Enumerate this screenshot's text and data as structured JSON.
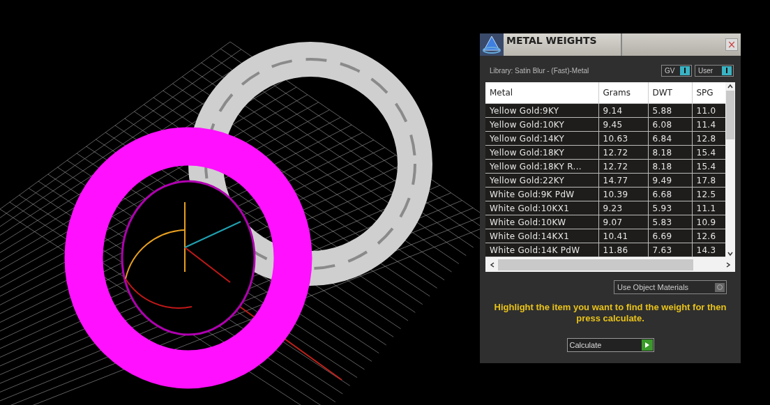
{
  "window": {
    "title": "METAL WEIGHTS",
    "close": "×"
  },
  "library": "Library: Satin Blur - (Fast)-Metal",
  "toggles": [
    {
      "label": "GV",
      "on": true
    },
    {
      "label": "User",
      "on": true
    }
  ],
  "table": {
    "columns": [
      "Metal",
      "Grams",
      "DWT",
      "SPG"
    ],
    "rows": [
      [
        "Yellow Gold:9KY",
        "9.14",
        "5.88",
        "11.0"
      ],
      [
        "Yellow Gold:10KY",
        "9.45",
        "6.08",
        "11.4"
      ],
      [
        "Yellow Gold:14KY",
        "10.63",
        "6.84",
        "12.8"
      ],
      [
        "Yellow Gold:18KY",
        "12.72",
        "8.18",
        "15.4"
      ],
      [
        "Yellow Gold:18KY R...",
        "12.72",
        "8.18",
        "15.4"
      ],
      [
        "Yellow Gold:22KY",
        "14.77",
        "9.49",
        "17.8"
      ],
      [
        "White Gold:9K PdW",
        "10.39",
        "6.68",
        "12.5"
      ],
      [
        "White Gold:10KX1",
        "9.23",
        "5.93",
        "11.1"
      ],
      [
        "White Gold:10KW",
        "9.07",
        "5.83",
        "10.9"
      ],
      [
        "White Gold:14KX1",
        "10.41",
        "6.69",
        "12.6"
      ],
      [
        "White Gold:14K PdW",
        "11.86",
        "7.63",
        "14.3"
      ]
    ]
  },
  "object_materials": {
    "label": "Use Object Materials",
    "on": false
  },
  "hint": "Highlight the item you want to find the weight for then press calculate.",
  "calculate": {
    "label": "Calculate"
  }
}
